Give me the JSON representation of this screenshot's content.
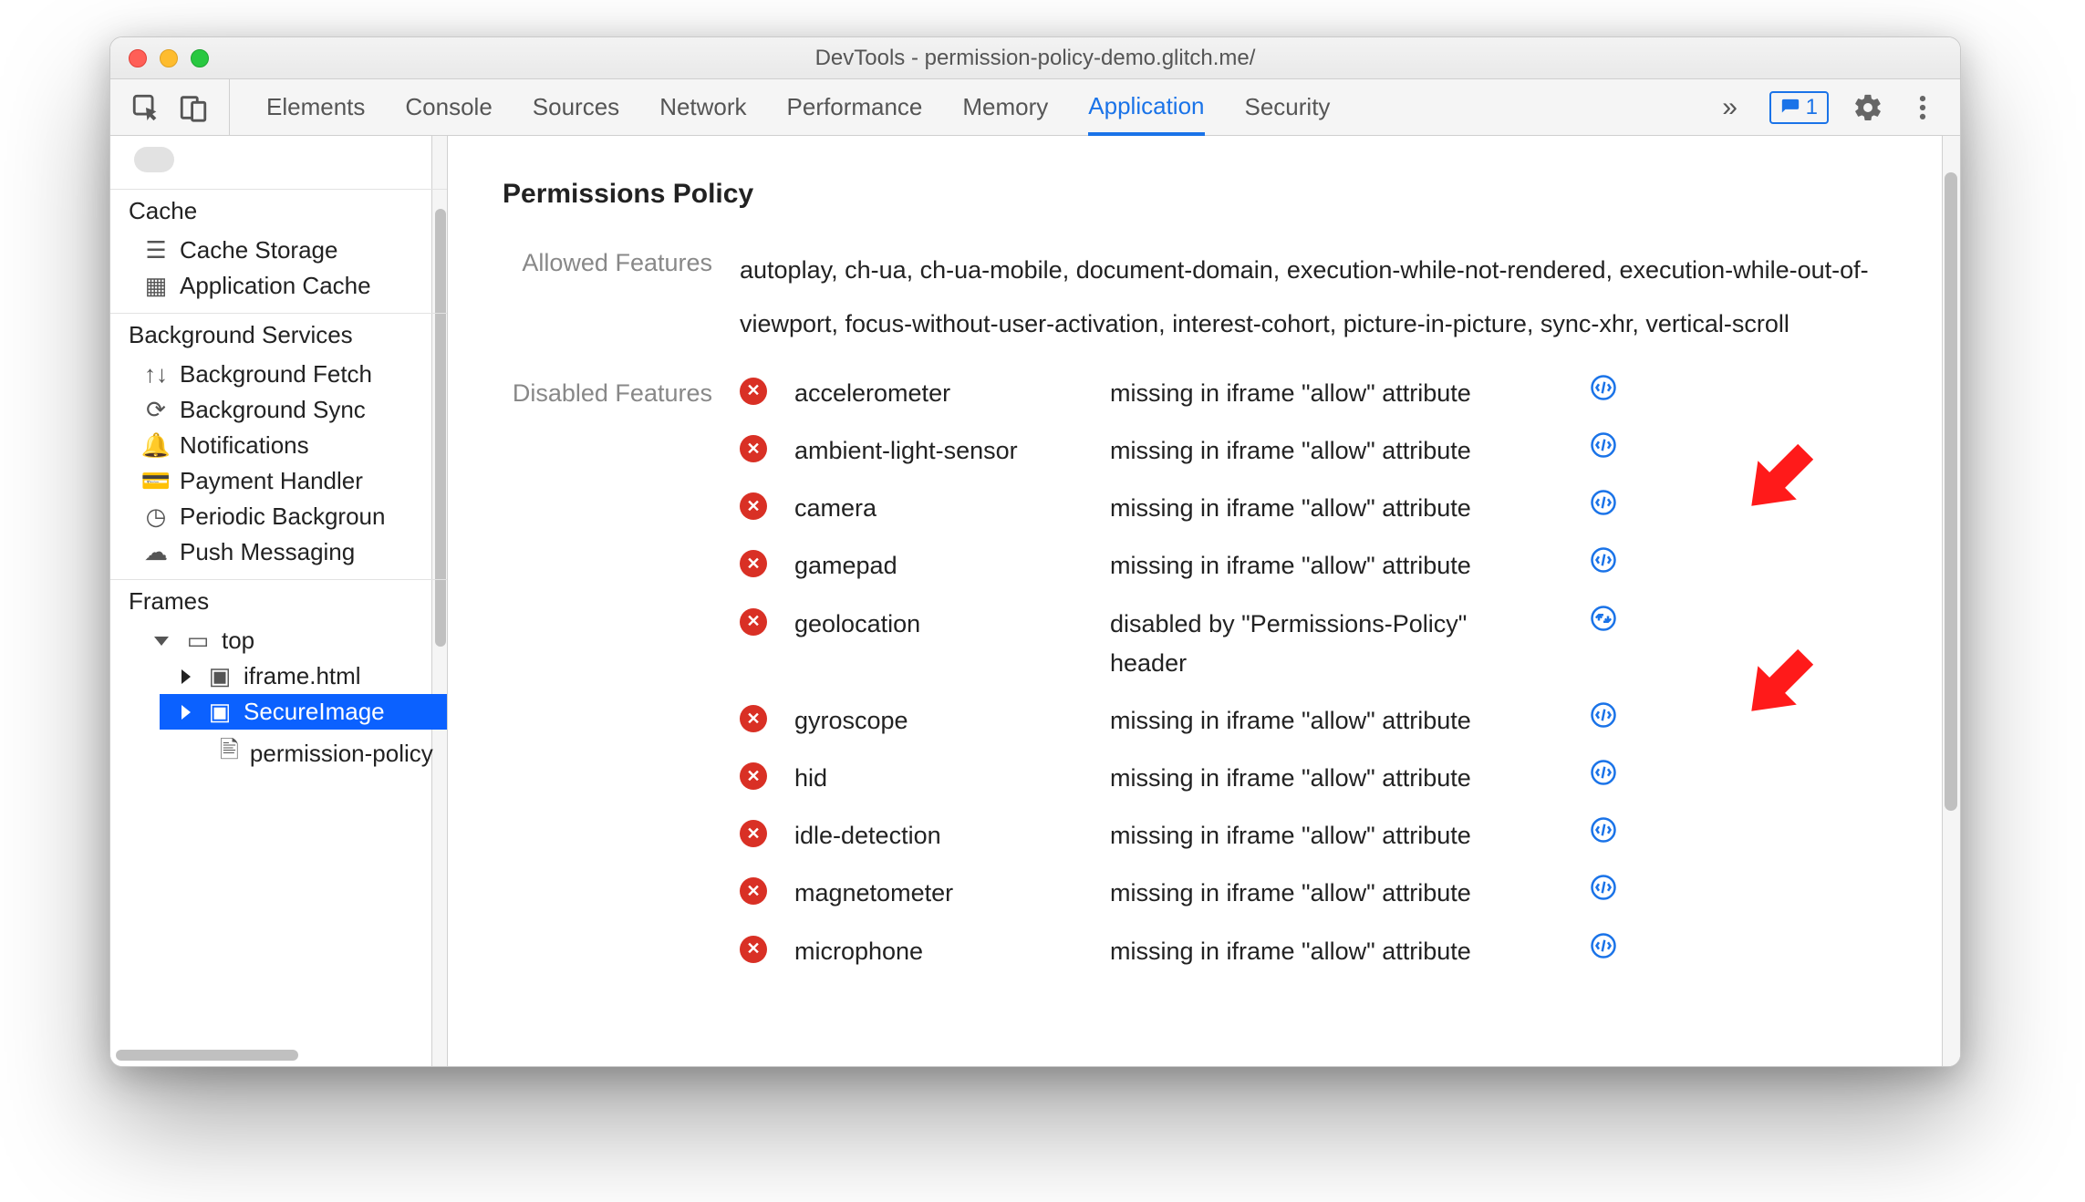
{
  "window": {
    "title": "DevTools - permission-policy-demo.glitch.me/"
  },
  "tabs": {
    "items": [
      "Elements",
      "Console",
      "Sources",
      "Network",
      "Performance",
      "Memory",
      "Application",
      "Security"
    ],
    "active": "Application",
    "issues_count": "1"
  },
  "sidebar": {
    "cache": {
      "title": "Cache",
      "items": [
        "Cache Storage",
        "Application Cache"
      ]
    },
    "bg": {
      "title": "Background Services",
      "items": [
        "Background Fetch",
        "Background Sync",
        "Notifications",
        "Payment Handler",
        "Periodic Backgroun",
        "Push Messaging"
      ]
    },
    "frames": {
      "title": "Frames",
      "root": "top",
      "children": {
        "iframe": "iframe.html",
        "secure": "SecureImage",
        "policy": "permission-policy"
      }
    }
  },
  "main": {
    "title": "Permissions Policy",
    "allowed_label": "Allowed Features",
    "allowed_text": "autoplay, ch-ua, ch-ua-mobile, document-domain, execution-while-not-rendered, execution-while-out-of-viewport, focus-without-user-activation, interest-cohort, picture-in-picture, sync-xhr, vertical-scroll",
    "disabled_label": "Disabled Features",
    "features": [
      {
        "name": "accelerometer",
        "reason": "missing in iframe \"allow\" attribute",
        "icon": "element"
      },
      {
        "name": "ambient-light-sensor",
        "reason": "missing in iframe \"allow\" attribute",
        "icon": "element"
      },
      {
        "name": "camera",
        "reason": "missing in iframe \"allow\" attribute",
        "icon": "element"
      },
      {
        "name": "gamepad",
        "reason": "missing in iframe \"allow\" attribute",
        "icon": "element"
      },
      {
        "name": "geolocation",
        "reason": "disabled by \"Permissions-Policy\" header",
        "icon": "network"
      },
      {
        "name": "gyroscope",
        "reason": "missing in iframe \"allow\" attribute",
        "icon": "element"
      },
      {
        "name": "hid",
        "reason": "missing in iframe \"allow\" attribute",
        "icon": "element"
      },
      {
        "name": "idle-detection",
        "reason": "missing in iframe \"allow\" attribute",
        "icon": "element"
      },
      {
        "name": "magnetometer",
        "reason": "missing in iframe \"allow\" attribute",
        "icon": "element"
      },
      {
        "name": "microphone",
        "reason": "missing in iframe \"allow\" attribute",
        "icon": "element"
      }
    ]
  }
}
